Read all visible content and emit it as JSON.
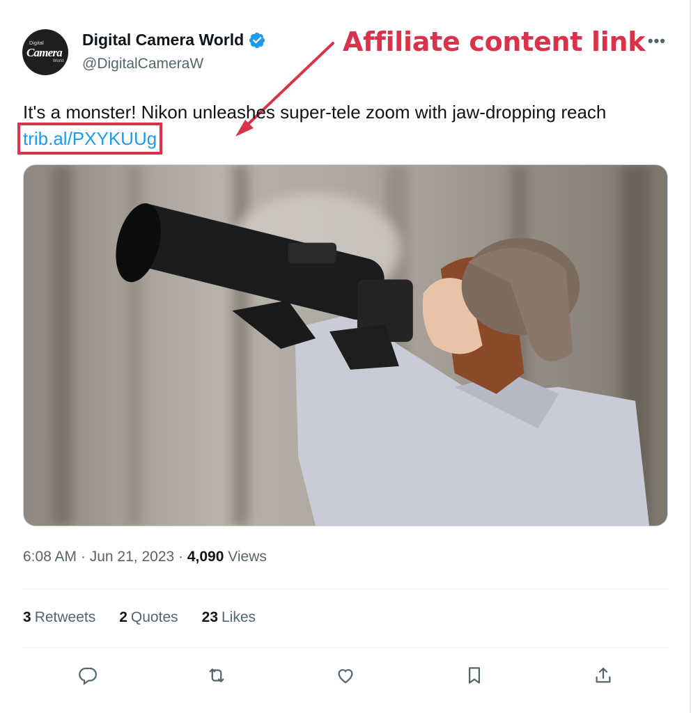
{
  "account": {
    "avatar_text_small": "Digital",
    "avatar_text_big": "Camera",
    "avatar_text_world": "World",
    "display_name": "Digital Camera World",
    "handle": "@DigitalCameraW",
    "verified_icon": "verified-badge-icon",
    "verified_color": "#1d9bf0"
  },
  "annotation": {
    "label": "Affiliate content link",
    "color": "#d8334a"
  },
  "tweet": {
    "text": "It's a monster! Nikon unleashes super-tele zoom with jaw-dropping reach",
    "link": "trib.al/PXYKUUg",
    "link_color": "#1d9bf0",
    "photo_icon": "photographer-with-telephoto-lens-image"
  },
  "meta": {
    "time": "6:08 AM",
    "date": "Jun 21, 2023",
    "views_count": "4,090",
    "views_label": "Views"
  },
  "stats": {
    "retweets_count": "3",
    "retweets_label": "Retweets",
    "quotes_count": "2",
    "quotes_label": "Quotes",
    "likes_count": "23",
    "likes_label": "Likes"
  },
  "actions": [
    "reply-icon",
    "retweet-icon",
    "like-icon",
    "bookmark-icon",
    "share-icon"
  ],
  "more_icon": "more-options-icon"
}
